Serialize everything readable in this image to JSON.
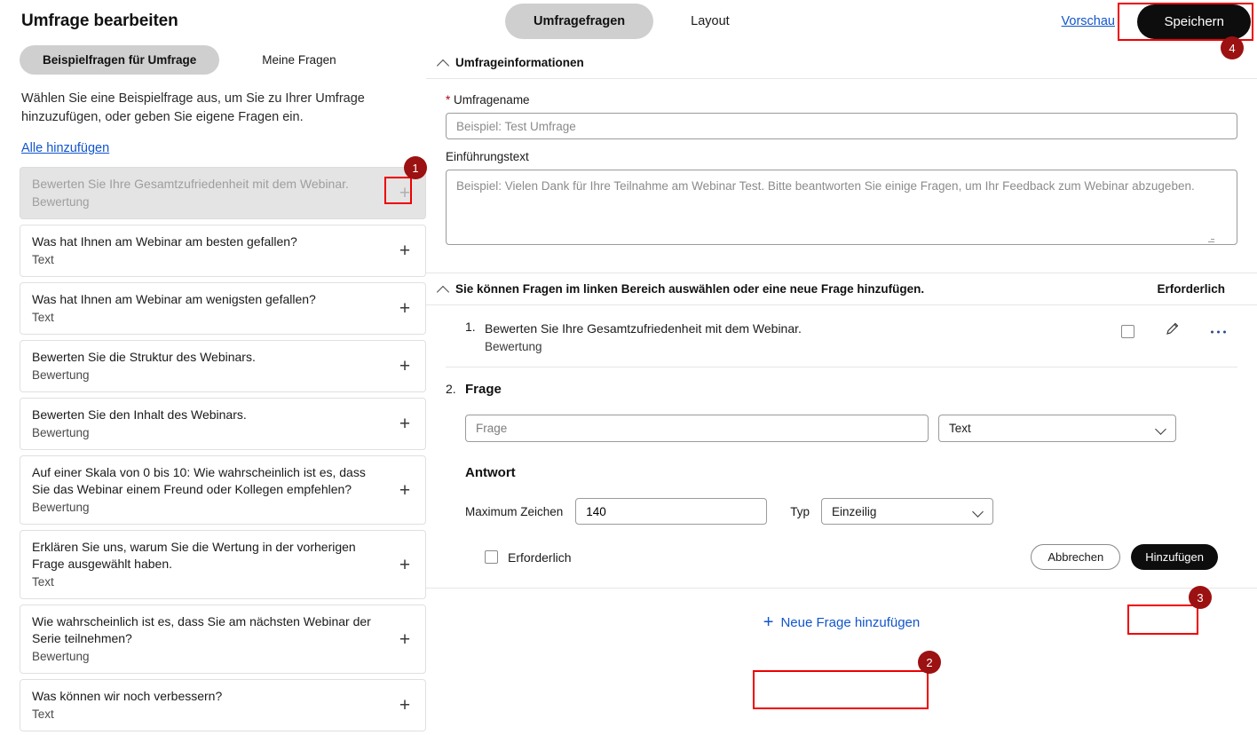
{
  "left": {
    "title": "Umfrage bearbeiten",
    "tabs": [
      {
        "label": "Beispielfragen für Umfrage",
        "active": true
      },
      {
        "label": "Meine Fragen",
        "active": false
      }
    ],
    "intro": "Wählen Sie eine Beispielfrage aus, um Sie zu Ihrer Umfrage hinzuzufügen, oder geben Sie eigene Fragen ein.",
    "add_all_link": "Alle hinzufügen",
    "add_icon": "plus-icon",
    "questions": [
      {
        "text": "Bewerten Sie Ihre Gesamtzufriedenheit mit dem Webinar.",
        "type": "Bewertung",
        "disabled": true
      },
      {
        "text": "Was hat Ihnen am Webinar am besten gefallen?",
        "type": "Text",
        "disabled": false
      },
      {
        "text": "Was hat Ihnen am Webinar am wenigsten gefallen?",
        "type": "Text",
        "disabled": false
      },
      {
        "text": "Bewerten Sie die Struktur des Webinars.",
        "type": "Bewertung",
        "disabled": false
      },
      {
        "text": "Bewerten Sie den Inhalt des Webinars.",
        "type": "Bewertung",
        "disabled": false
      },
      {
        "text": "Auf einer Skala von 0 bis 10: Wie wahrscheinlich ist es, dass Sie das Webinar einem Freund oder Kollegen empfehlen?",
        "type": "Bewertung",
        "disabled": false
      },
      {
        "text": "Erklären Sie uns, warum Sie die Wertung in der vorherigen Frage ausgewählt haben.",
        "type": "Text",
        "disabled": false
      },
      {
        "text": "Wie wahrscheinlich ist es, dass Sie am nächsten Webinar der Serie teilnehmen?",
        "type": "Bewertung",
        "disabled": false
      },
      {
        "text": "Was können wir noch verbessern?",
        "type": "Text",
        "disabled": false
      }
    ]
  },
  "top": {
    "tabs": [
      {
        "label": "Umfragefragen",
        "active": true
      },
      {
        "label": "Layout",
        "active": false
      }
    ],
    "preview_label": "Vorschau",
    "save_label": "Speichern"
  },
  "info_section": {
    "heading": "Umfrageinformationen",
    "collapse_icon": "chevron-up-icon",
    "name_label": "Umfragename",
    "name_required_marker": "*",
    "name_value": "",
    "name_placeholder": "Beispiel: Test Umfrage",
    "intro_label": "Einführungstext",
    "intro_value": "",
    "intro_placeholder": "Beispiel: Vielen Dank für Ihre Teilnahme am Webinar Test. Bitte beantworten Sie einige Fragen, um Ihr Feedback zum Webinar abzugeben."
  },
  "questions_section": {
    "heading": "Sie können Fragen im linken Bereich auswählen oder eine neue Frage hinzufügen.",
    "collapse_icon": "chevron-up-icon",
    "required_column_label": "Erforderlich",
    "added": [
      {
        "number": "1.",
        "text": "Bewerten Sie Ihre Gesamtzufriedenheit mit dem Webinar.",
        "type": "Bewertung",
        "required_checked": false,
        "edit_icon": "pencil-icon",
        "more_icon": "ellipsis-icon"
      }
    ],
    "editor": {
      "number": "2.",
      "title": "Frage",
      "question_value": "",
      "question_placeholder": "Frage",
      "type_value": "Text",
      "type_caret_icon": "chevron-down-icon",
      "answer_heading": "Antwort",
      "max_chars_label": "Maximum Zeichen",
      "max_chars_value": "140",
      "typ_label": "Typ",
      "typ_value": "Einzeilig",
      "typ_caret_icon": "chevron-down-icon",
      "required_label": "Erforderlich",
      "required_checked": false,
      "cancel_label": "Abbrechen",
      "add_label": "Hinzufügen"
    },
    "new_question_label": "Neue Frage hinzufügen",
    "new_question_icon": "plus-icon"
  },
  "annotations": {
    "badge_color": "#9c1111",
    "highlight_color": "#ee0000",
    "badges": [
      {
        "label": "1"
      },
      {
        "label": "2"
      },
      {
        "label": "3"
      },
      {
        "label": "4"
      }
    ]
  }
}
